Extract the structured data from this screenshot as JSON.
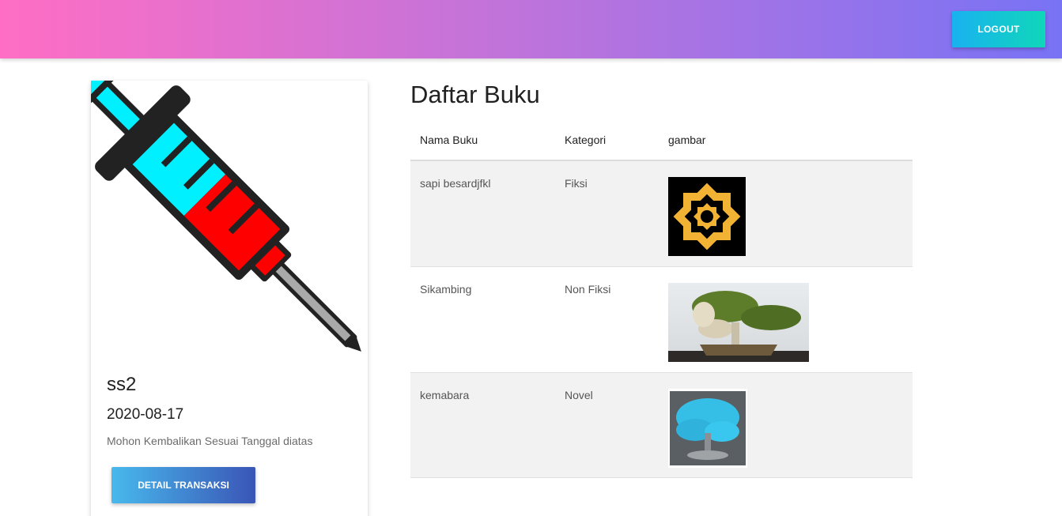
{
  "header": {
    "logout_label": "LOGOUT",
    "gradient": [
      "#ff6ec4",
      "#7873f5"
    ]
  },
  "card": {
    "image_icon": "syringe-icon",
    "title": "ss2",
    "date": "2020-08-17",
    "note": "Mohon Kembalikan Sesuai Tanggal diatas",
    "button_label": "DETAIL TRANSAKSI"
  },
  "books": {
    "heading": "Daftar Buku",
    "columns": [
      "Nama Buku",
      "Kategori",
      "gambar"
    ],
    "rows": [
      {
        "name": "sapi besardjfkl",
        "category": "Fiksi",
        "image": "gold-star-ornament"
      },
      {
        "name": "Sikambing",
        "category": "Non Fiksi",
        "image": "bonsai-tree-photo"
      },
      {
        "name": "kemabara",
        "category": "Novel",
        "image": "blue-bonsai-photo"
      }
    ]
  }
}
